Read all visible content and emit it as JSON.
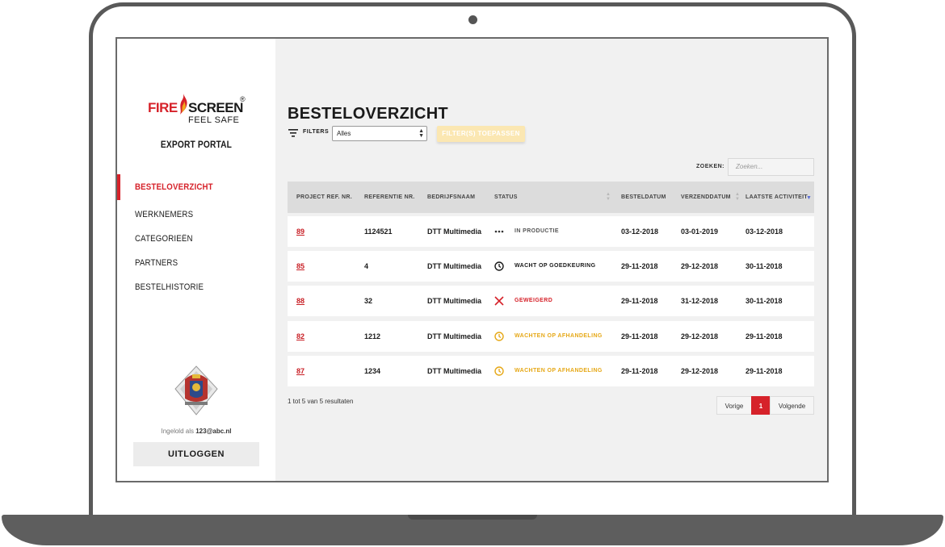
{
  "brand": {
    "logo_fire": "FIRE",
    "logo_screen": "SCREEN",
    "logo_reg": "®",
    "logo_tagline": "FEEL SAFE",
    "portal_title": "EXPORT PORTAL",
    "accent_color": "#d6222a"
  },
  "sidebar": {
    "items": [
      {
        "label": "BESTELOVERZICHT",
        "active": true
      },
      {
        "label": "WERKNEMERS",
        "active": false
      },
      {
        "label": "CATEGORIEËN",
        "active": false
      },
      {
        "label": "PARTNERS",
        "active": false
      },
      {
        "label": "BESTELHISTORIE",
        "active": false
      }
    ],
    "logged_in_prefix": "Ingelold als",
    "logged_in_user": "123@abc.nl",
    "logout_label": "UITLOGGEN"
  },
  "main": {
    "title": "BESTELOVERZICHT",
    "filters_label": "FILTERS",
    "filter_value": "Alles",
    "apply_label": "FILTER(S) TOEPASSEN",
    "search_label": "ZOEKEN:",
    "search_placeholder": "Zoeken...",
    "columns": [
      "PROJECT REF. NR.",
      "REFERENTIE NR.",
      "BEDRIJFSNAAM",
      "STATUS",
      "BESTELDATUM",
      "VERZENDDATUM",
      "LAATSTE ACTIVITEIT"
    ],
    "sorted_column": "LAATSTE ACTIVITEIT",
    "sort_direction": "desc",
    "rows": [
      {
        "project": "89",
        "referentie": "1124521",
        "bedrijf": "DTT Multimedia",
        "status": "IN PRODUCTIE",
        "status_icon": "dots-icon",
        "status_color": "#555555",
        "besteldatum": "03-12-2018",
        "verzenddatum": "03-01-2019",
        "laatste": "03-12-2018"
      },
      {
        "project": "85",
        "referentie": "4",
        "bedrijf": "DTT Multimedia",
        "status": "WACHT OP GOEDKEURING",
        "status_icon": "clock-icon",
        "status_color": "#1a1a1a",
        "besteldatum": "29-11-2018",
        "verzenddatum": "29-12-2018",
        "laatste": "30-11-2018"
      },
      {
        "project": "88",
        "referentie": "32",
        "bedrijf": "DTT Multimedia",
        "status": "GEWEIGERD",
        "status_icon": "cross-icon",
        "status_color": "#d6222a",
        "besteldatum": "29-11-2018",
        "verzenddatum": "31-12-2018",
        "laatste": "30-11-2018"
      },
      {
        "project": "82",
        "referentie": "1212",
        "bedrijf": "DTT Multimedia",
        "status": "WACHTEN OP AFHANDELING",
        "status_icon": "clock-icon",
        "status_color": "#e6a817",
        "besteldatum": "29-11-2018",
        "verzenddatum": "29-12-2018",
        "laatste": "29-11-2018"
      },
      {
        "project": "87",
        "referentie": "1234",
        "bedrijf": "DTT Multimedia",
        "status": "WACHTEN OP AFHANDELING",
        "status_icon": "clock-icon",
        "status_color": "#e6a817",
        "besteldatum": "29-11-2018",
        "verzenddatum": "29-12-2018",
        "laatste": "29-11-2018"
      }
    ],
    "results_text": "1 tot 5 van 5 resultaten",
    "pager": {
      "prev": "Vorige",
      "current": "1",
      "next": "Volgende"
    }
  }
}
